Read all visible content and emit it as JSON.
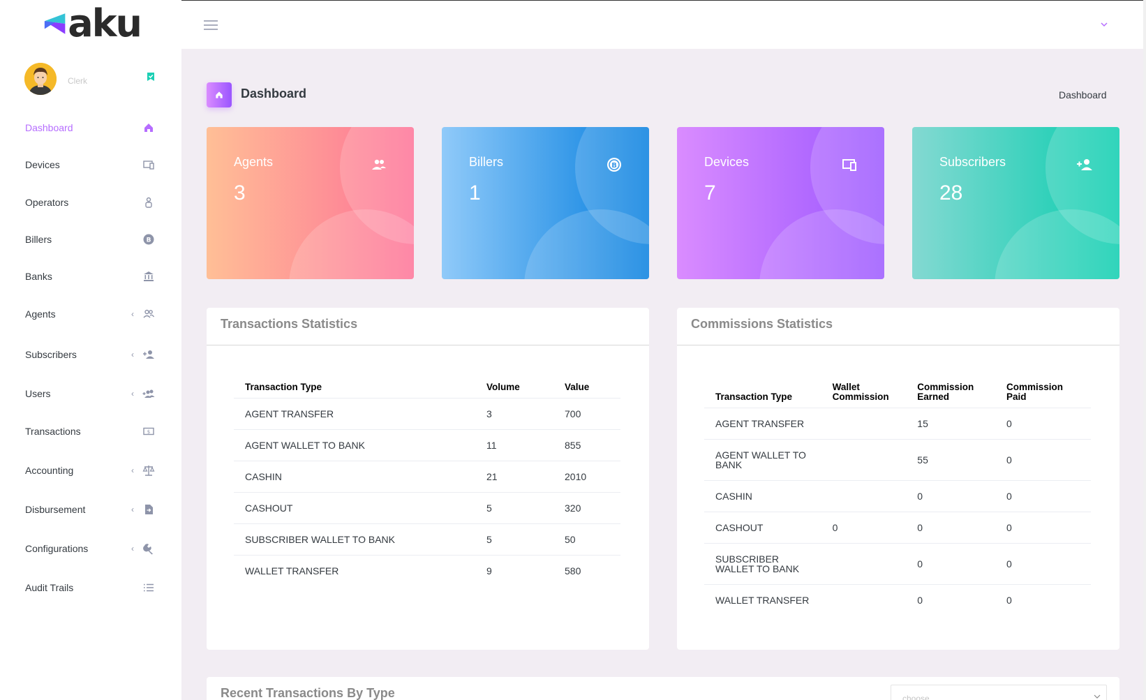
{
  "brand": {
    "name": "aku",
    "logo_colors": [
      "#4c6ef5",
      "#8b3dff",
      "#34c3d6"
    ]
  },
  "profile": {
    "role": "Clerk",
    "avatar_icon": "user-avatar-icon",
    "status_icon": "verified-bookmark-icon"
  },
  "sidebar": {
    "items": [
      {
        "label": "Dashboard",
        "icon": "home-icon",
        "active": true,
        "has_submenu": false
      },
      {
        "label": "Devices",
        "icon": "devices-icon",
        "active": false,
        "has_submenu": false
      },
      {
        "label": "Operators",
        "icon": "operator-icon",
        "active": false,
        "has_submenu": false
      },
      {
        "label": "Billers",
        "icon": "bitcoin-icon",
        "active": false,
        "has_submenu": false
      },
      {
        "label": "Banks",
        "icon": "bank-icon",
        "active": false,
        "has_submenu": false
      },
      {
        "label": "Agents",
        "icon": "account-group-icon",
        "active": false,
        "has_submenu": true
      },
      {
        "label": "Subscribers",
        "icon": "account-plus-icon",
        "active": false,
        "has_submenu": true
      },
      {
        "label": "Users",
        "icon": "account-multiple-plus-icon",
        "active": false,
        "has_submenu": true
      },
      {
        "label": "Transactions",
        "icon": "cash-icon",
        "active": false,
        "has_submenu": false
      },
      {
        "label": "Accounting",
        "icon": "scale-balance-icon",
        "active": false,
        "has_submenu": true
      },
      {
        "label": "Disbursement",
        "icon": "file-send-icon",
        "active": false,
        "has_submenu": true
      },
      {
        "label": "Configurations",
        "icon": "wrench-icon",
        "active": false,
        "has_submenu": true
      },
      {
        "label": "Audit Trails",
        "icon": "format-list-icon",
        "active": false,
        "has_submenu": false
      }
    ]
  },
  "page": {
    "title": "Dashboard",
    "breadcrumb": "Dashboard"
  },
  "cards": [
    {
      "title": "Agents",
      "value": "3",
      "icon": "account-group-icon",
      "gradient": [
        "#ffbf96",
        "#fe7096"
      ]
    },
    {
      "title": "Billers",
      "value": "1",
      "icon": "bitcoin-icon",
      "gradient": [
        "#90caf9",
        "#047edf"
      ]
    },
    {
      "title": "Devices",
      "value": "7",
      "icon": "devices-icon",
      "gradient": [
        "#da8cff",
        "#9a55ff"
      ]
    },
    {
      "title": "Subscribers",
      "value": "28",
      "icon": "account-plus-icon",
      "gradient": [
        "#84d9d2",
        "#07cdae"
      ]
    }
  ],
  "transactions": {
    "title": "Transactions Statistics",
    "headers": [
      "Transaction Type",
      "Volume",
      "Value"
    ],
    "rows": [
      [
        "AGENT TRANSFER",
        "3",
        "700"
      ],
      [
        "AGENT WALLET TO BANK",
        "11",
        "855"
      ],
      [
        "CASHIN",
        "21",
        "2010"
      ],
      [
        "CASHOUT",
        "5",
        "320"
      ],
      [
        "SUBSCRIBER WALLET TO BANK",
        "5",
        "50"
      ],
      [
        "WALLET TRANSFER",
        "9",
        "580"
      ]
    ]
  },
  "commissions": {
    "title": "Commissions Statistics",
    "headers": [
      "Transaction Type",
      "Wallet Commission",
      "Commission Earned",
      "Commission Paid"
    ],
    "rows": [
      [
        "AGENT TRANSFER",
        "",
        "15",
        "0"
      ],
      [
        "AGENT WALLET TO BANK",
        "",
        "55",
        "0"
      ],
      [
        "CASHIN",
        "",
        "0",
        "0"
      ],
      [
        "CASHOUT",
        "0",
        "0",
        "0"
      ],
      [
        "SUBSCRIBER WALLET TO BANK",
        "",
        "0",
        "0"
      ],
      [
        "WALLET TRANSFER",
        "",
        "0",
        "0"
      ]
    ]
  },
  "recent": {
    "title": "Recent Transactions By Type",
    "select_value": "choose"
  },
  "colors": {
    "accent": "#b66dff",
    "background": "#f2edf3",
    "icon_muted": "#8e94a9"
  }
}
